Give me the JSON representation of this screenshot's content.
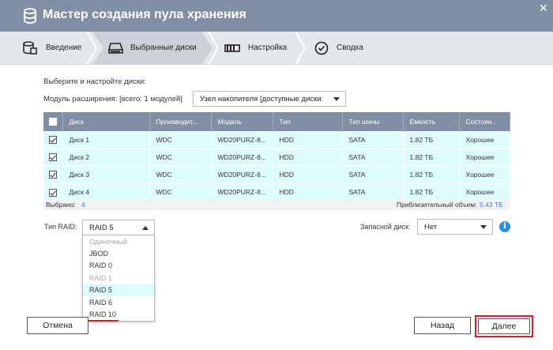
{
  "window": {
    "title": "Мастер создания пула хранения",
    "close_glyph": "✕"
  },
  "steps": [
    {
      "label": "Введение",
      "icon": "database-icon",
      "active": false
    },
    {
      "label": "Выбранные диски",
      "icon": "disk-drive-icon",
      "active": true
    },
    {
      "label": "Настройка",
      "icon": "settings-strip-icon",
      "active": false
    },
    {
      "label": "Сводка",
      "icon": "check-circle-icon",
      "active": false
    }
  ],
  "main": {
    "instruction": "Выберите и настройте диски:",
    "expansion_label": "Модуль расширения: [всего: 1 модулей]",
    "expansion_value": "Узел накопителя [доступные диски:"
  },
  "table": {
    "columns": [
      "Диск",
      "Производит...",
      "Модель",
      "Тип",
      "Тип шины",
      "Емкость",
      "Состоян..."
    ],
    "rows": [
      {
        "checked": true,
        "disk": "Диск 1",
        "vendor": "WDC",
        "model": "WD20PURZ-8...",
        "type": "HDD",
        "bus": "SATA",
        "capacity": "1.82 ТБ",
        "status": "Хорошее"
      },
      {
        "checked": true,
        "disk": "Диск 2",
        "vendor": "WDC",
        "model": "WD20PURZ-8...",
        "type": "HDD",
        "bus": "SATA",
        "capacity": "1.82 ТБ",
        "status": "Хорошее"
      },
      {
        "checked": true,
        "disk": "Диск 3",
        "vendor": "WDC",
        "model": "WD20PURZ-8...",
        "type": "HDD",
        "bus": "SATA",
        "capacity": "1.82 ТБ",
        "status": "Хорошее"
      },
      {
        "checked": true,
        "disk": "Диск 4",
        "vendor": "WDC",
        "model": "WD20PURZ-8...",
        "type": "HDD",
        "bus": "SATA",
        "capacity": "1.82 ТБ",
        "status": "Хорошее"
      }
    ],
    "selected_label": "Выбрано:",
    "selected_count": "4",
    "approx_label": "Приблизительный объем:",
    "approx_value": "5.43 ТБ"
  },
  "raid": {
    "label": "Тип RAID:",
    "selected": "RAID 5",
    "options": [
      {
        "label": "Одиночный",
        "disabled": true
      },
      {
        "label": "JBOD",
        "disabled": false
      },
      {
        "label": "RAID 0",
        "disabled": false
      },
      {
        "label": "RAID 1",
        "disabled": true
      },
      {
        "label": "RAID 5",
        "disabled": false,
        "selected": true
      },
      {
        "label": "RAID 6",
        "disabled": false
      },
      {
        "label": "RAID 10",
        "disabled": false
      }
    ]
  },
  "spare": {
    "label": "Запасной диск:",
    "value": "Нет"
  },
  "buttons": {
    "cancel": "Отмена",
    "back": "Назад",
    "next": "Далее"
  },
  "colors": {
    "titlebar": "#808fa3",
    "row_bg": "#dffcfc",
    "highlight": "#e0192b",
    "link": "#3b7dd8",
    "info": "#2b8fe0"
  }
}
